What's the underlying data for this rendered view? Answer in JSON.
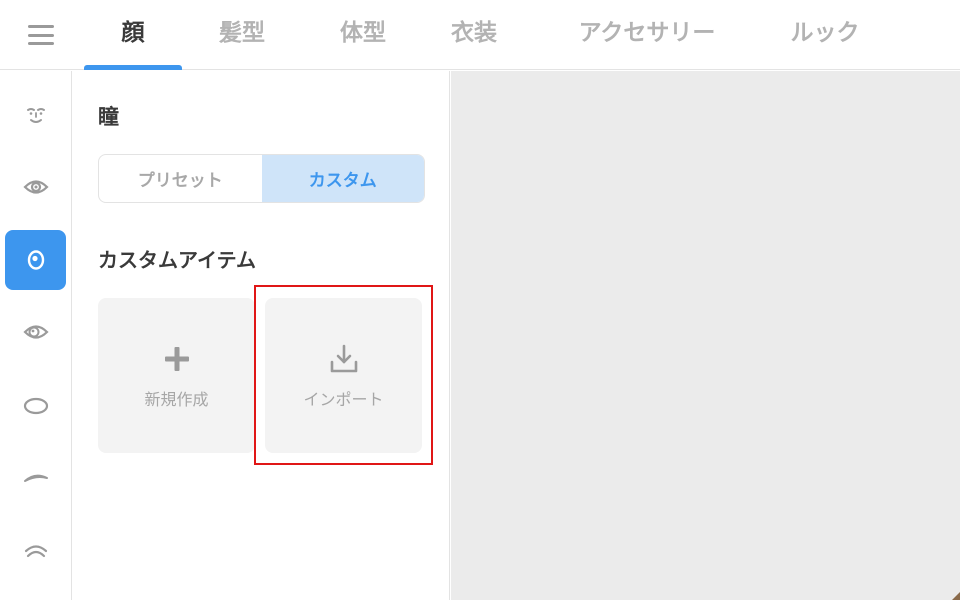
{
  "header": {
    "menu_icon": "hamburger-icon",
    "tabs": [
      {
        "label": "顔",
        "active": true
      },
      {
        "label": "髪型",
        "active": false
      },
      {
        "label": "体型",
        "active": false
      },
      {
        "label": "衣装",
        "active": false
      },
      {
        "label": "アクセサリー",
        "active": false
      },
      {
        "label": "ルック",
        "active": false
      }
    ]
  },
  "sidebar": {
    "items": [
      {
        "icon": "face-icon",
        "active": false
      },
      {
        "icon": "eye-icon",
        "active": false
      },
      {
        "icon": "pupil-icon",
        "active": true
      },
      {
        "icon": "eye-white-icon",
        "active": false
      },
      {
        "icon": "eye-shape-icon",
        "active": false
      },
      {
        "icon": "eyebrow-icon",
        "active": false
      },
      {
        "icon": "eyelash-icon",
        "active": false
      }
    ]
  },
  "panel": {
    "title": "瞳",
    "segment": {
      "preset_label": "プリセット",
      "custom_label": "カスタム",
      "selected": "custom"
    },
    "custom_items_title": "カスタムアイテム",
    "new_card": {
      "label": "新規作成",
      "icon": "plus-icon"
    },
    "import_card": {
      "label": "インポート",
      "icon": "import-icon"
    }
  },
  "colors": {
    "accent": "#3d96ee",
    "accent_light": "#cfe4f9",
    "highlight": "#e01616",
    "preview_bg": "#ebebeb"
  }
}
